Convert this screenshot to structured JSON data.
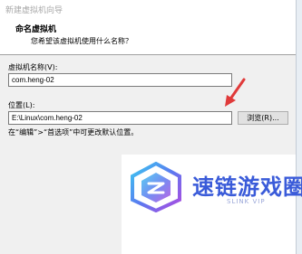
{
  "window": {
    "title": "新建虚拟机向导"
  },
  "header": {
    "title": "命名虚拟机",
    "subtitle": "您希望该虚拟机使用什么名称？"
  },
  "form": {
    "vm_name_label": "虚拟机名称(V):",
    "vm_name_value": "com.heng-02",
    "location_label": "位置(L):",
    "location_value": "E:\\Linux\\com.heng-02",
    "browse_label": "浏览(R)...",
    "hint": "在“编辑”>“首选项”中可更改默认位置。"
  },
  "watermark": {
    "text": "速链游戏圈",
    "sub": "SLINK VIP"
  },
  "colors": {
    "arrow": "#e03a3a",
    "watermark": "#3a5bd9",
    "body_bg": "#f0f0f0"
  }
}
